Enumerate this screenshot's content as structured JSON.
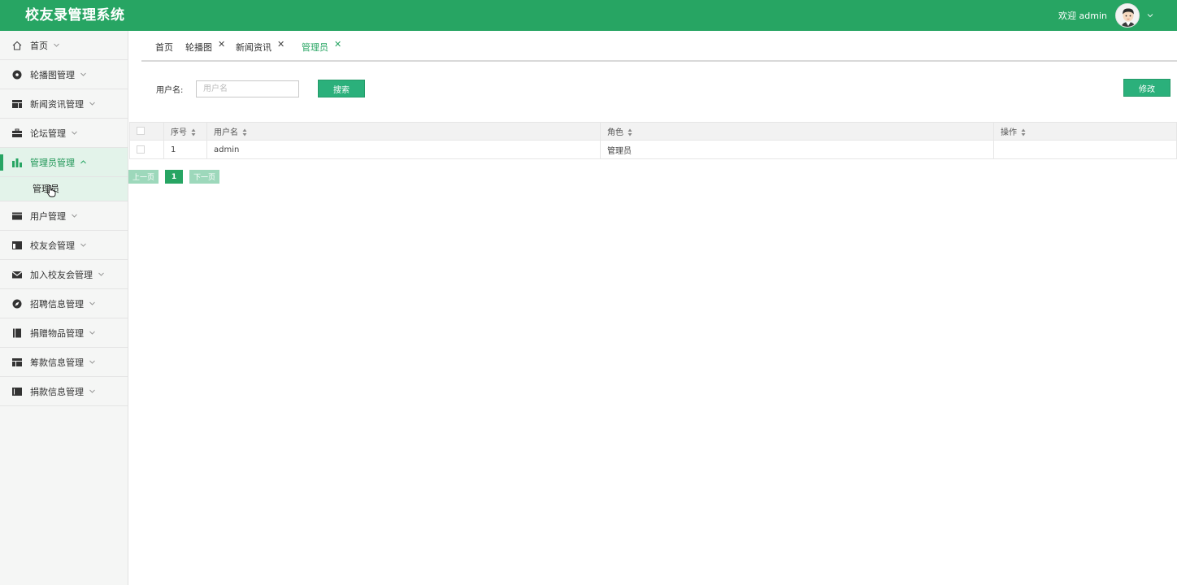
{
  "header": {
    "title": "校友录管理系统",
    "welcome": "欢迎 admin"
  },
  "colors": {
    "brand": "#27a563",
    "button": "#2bb07b",
    "pager_disabled": "#9dd8bb",
    "active_bg": "#e3f3ea"
  },
  "sidebar": {
    "items": [
      {
        "label": "首页",
        "icon": "home-icon"
      },
      {
        "label": "轮播图管理",
        "icon": "disc-icon"
      },
      {
        "label": "新闻资讯管理",
        "icon": "layout-icon"
      },
      {
        "label": "论坛管理",
        "icon": "briefcase-icon"
      },
      {
        "label": "管理员管理",
        "icon": "bar-chart-icon",
        "expanded": true,
        "active": true
      },
      {
        "label": "用户管理",
        "icon": "card-icon"
      },
      {
        "label": "校友会管理",
        "icon": "table-icon"
      },
      {
        "label": "加入校友会管理",
        "icon": "envelope-icon"
      },
      {
        "label": "招聘信息管理",
        "icon": "compass-icon"
      },
      {
        "label": "捐赠物品管理",
        "icon": "book-icon"
      },
      {
        "label": "筹款信息管理",
        "icon": "grid-icon"
      },
      {
        "label": "捐款信息管理",
        "icon": "panel-icon"
      }
    ],
    "sub_item": "管理员"
  },
  "tabs": [
    {
      "label": "首页",
      "closable": false
    },
    {
      "label": "轮播图",
      "closable": true
    },
    {
      "label": "新闻资讯",
      "closable": true
    },
    {
      "label": "管理员",
      "closable": true,
      "active": true
    }
  ],
  "search": {
    "label": "用户名:",
    "placeholder": "用户名",
    "value": "",
    "button": "搜索"
  },
  "actions": {
    "edit": "修改"
  },
  "table": {
    "columns": [
      "序号",
      "用户名",
      "角色",
      "操作"
    ],
    "rows": [
      {
        "index": "1",
        "username": "admin",
        "role": "管理员",
        "ops": ""
      }
    ]
  },
  "pagination": {
    "prev": "上一页",
    "current": "1",
    "next": "下一页"
  }
}
